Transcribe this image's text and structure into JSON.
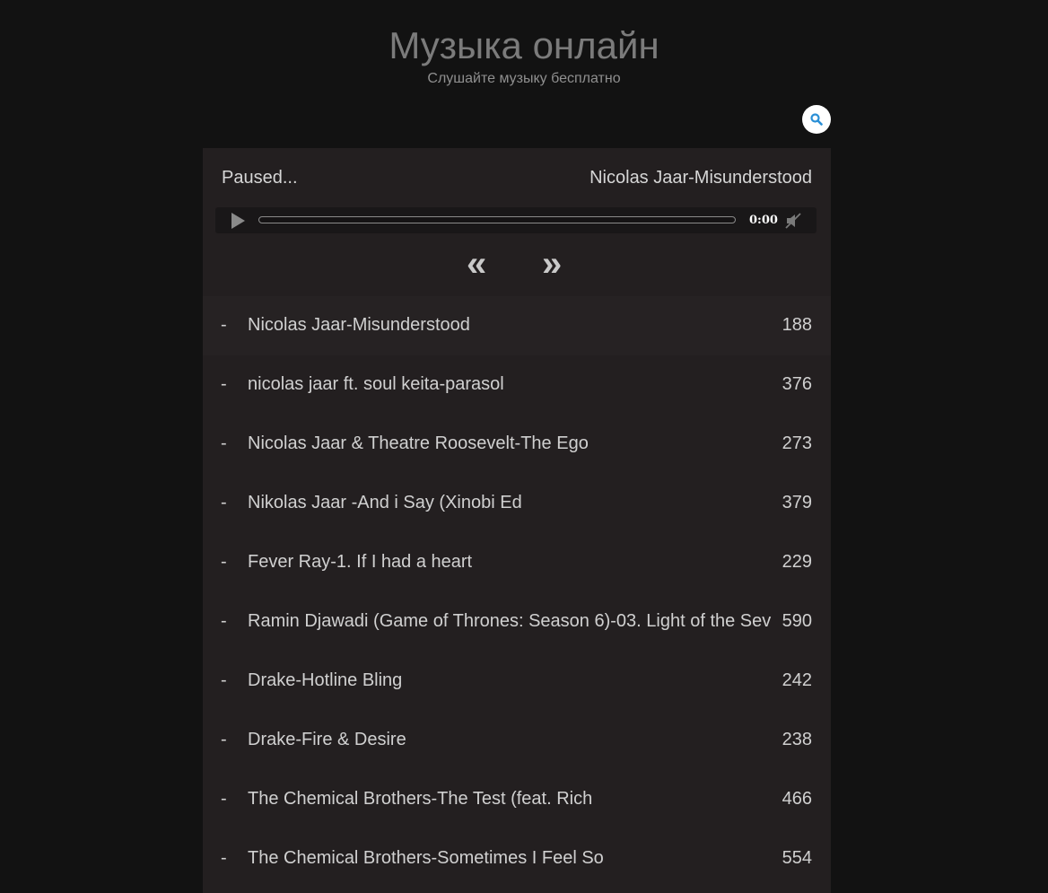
{
  "header": {
    "title": "Музыка онлайн",
    "subtitle": "Слушайте музыку бесплатно",
    "search_icon": "search-icon"
  },
  "player": {
    "status": "Paused...",
    "now_playing": "Nicolas Jaar-Misunderstood",
    "time": "0:00",
    "progress": 0,
    "play_icon": "play-icon",
    "mute_icon": "mute-icon",
    "prev_label": "«",
    "next_label": "»"
  },
  "tracks": [
    {
      "dash": "-",
      "title": "Nicolas Jaar-Misunderstood",
      "duration": "188"
    },
    {
      "dash": "-",
      "title": "nicolas jaar ft. soul keita-parasol",
      "duration": "376"
    },
    {
      "dash": "-",
      "title": "Nicolas Jaar & Theatre Roosevelt-The Ego",
      "duration": "273"
    },
    {
      "dash": "-",
      "title": "Nikolas Jaar -And i Say (Xinobi Ed",
      "duration": "379"
    },
    {
      "dash": "-",
      "title": "Fever Ray-1. If I had a heart",
      "duration": "229"
    },
    {
      "dash": "-",
      "title": "Ramin Djawadi (Game of Thrones: Season 6)-03. Light of the Sev",
      "duration": "590"
    },
    {
      "dash": "-",
      "title": "Drake-Hotline Bling",
      "duration": "242"
    },
    {
      "dash": "-",
      "title": "Drake-Fire & Desire",
      "duration": "238"
    },
    {
      "dash": "-",
      "title": "The Chemical Brothers-The Test (feat. Rich",
      "duration": "466"
    },
    {
      "dash": "-",
      "title": "The Chemical Brothers-Sometimes I Feel So",
      "duration": "554"
    }
  ],
  "colors": {
    "background": "#121212",
    "panel": "#231f20",
    "accent": "#2a8fd6"
  }
}
